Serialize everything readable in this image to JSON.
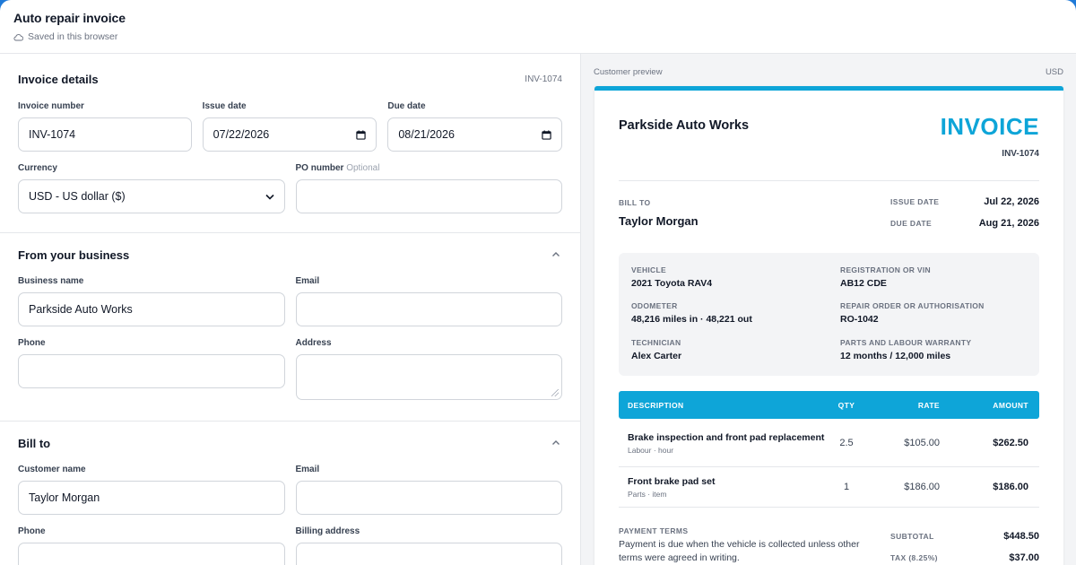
{
  "header": {
    "title": "Auto repair invoice",
    "saved_status": "Saved in this browser"
  },
  "invoice_details": {
    "title": "Invoice details",
    "ref": "INV-1074",
    "invoice_number_label": "Invoice number",
    "invoice_number": "INV-1074",
    "issue_date_label": "Issue date",
    "issue_date": "07/22/2026",
    "due_date_label": "Due date",
    "due_date": "08/21/2026",
    "currency_label": "Currency",
    "currency": "USD - US dollar ($)",
    "po_label": "PO number",
    "po_optional": "Optional",
    "po_value": ""
  },
  "from_business": {
    "title": "From your business",
    "business_name_label": "Business name",
    "business_name": "Parkside Auto Works",
    "email_label": "Email",
    "email": "",
    "phone_label": "Phone",
    "phone": "",
    "address_label": "Address",
    "address": ""
  },
  "bill_to": {
    "title": "Bill to",
    "customer_name_label": "Customer name",
    "customer_name": "Taylor Morgan",
    "email_label": "Email",
    "email": "",
    "phone_label": "Phone",
    "phone": "",
    "billing_address_label": "Billing address",
    "billing_address": ""
  },
  "preview": {
    "label": "Customer preview",
    "currency": "USD",
    "business": "Parkside Auto Works",
    "invoice_word": "INVOICE",
    "invoice_number": "INV-1074",
    "bill_to_label": "BILL TO",
    "bill_to_name": "Taylor Morgan",
    "issue_date_label": "ISSUE DATE",
    "issue_date": "Jul 22, 2026",
    "due_date_label": "DUE DATE",
    "due_date": "Aug 21, 2026",
    "vehicle": {
      "vehicle_label": "VEHICLE",
      "vehicle": "2021 Toyota RAV4",
      "reg_label": "REGISTRATION OR VIN",
      "reg": "AB12 CDE",
      "odometer_label": "ODOMETER",
      "odometer": "48,216 miles in · 48,221 out",
      "ro_label": "REPAIR ORDER OR AUTHORISATION",
      "ro": "RO-1042",
      "tech_label": "TECHNICIAN",
      "tech": "Alex Carter",
      "warranty_label": "PARTS AND LABOUR WARRANTY",
      "warranty": "12 months / 12,000 miles"
    },
    "table": {
      "headers": {
        "description": "DESCRIPTION",
        "qty": "QTY",
        "rate": "RATE",
        "amount": "AMOUNT"
      },
      "rows": [
        {
          "description": "Brake inspection and front pad replacement",
          "sub": "Labour · hour",
          "qty": "2.5",
          "rate": "$105.00",
          "amount": "$262.50"
        },
        {
          "description": "Front brake pad set",
          "sub": "Parts · item",
          "qty": "1",
          "rate": "$186.00",
          "amount": "$186.00"
        }
      ]
    },
    "terms_label": "PAYMENT TERMS",
    "terms": "Payment is due when the vehicle is collected unless other terms were agreed in writing.",
    "subtotal_label": "SUBTOTAL",
    "subtotal": "$448.50",
    "tax_label": "TAX (8.25%)",
    "tax": "$37.00"
  },
  "colors": {
    "accent": "#0ea5d8",
    "window_frame": "#1f7ad8"
  },
  "icons": {
    "saved": "cloud-icon",
    "collapse": "chevron-up-icon",
    "date": "calendar-icon",
    "select": "chevron-down-icon"
  }
}
